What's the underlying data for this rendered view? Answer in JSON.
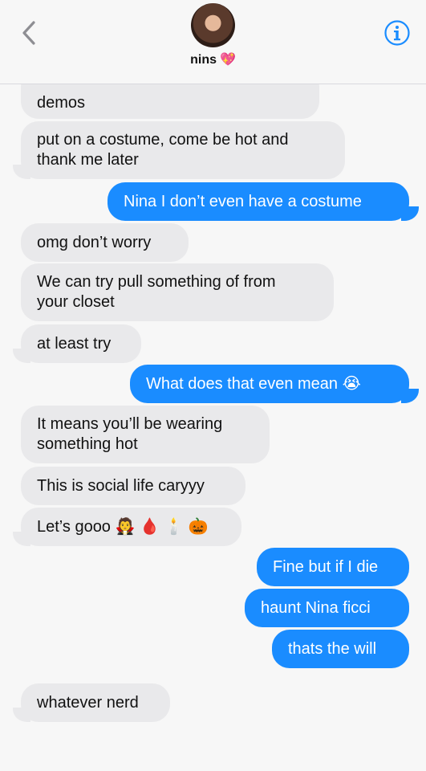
{
  "header": {
    "contact_name": "nins",
    "contact_emoji": "💖",
    "back_icon": "chevron-left-icon",
    "info_icon": "info-icon"
  },
  "messages": [
    {
      "side": "in",
      "text": "demos"
    },
    {
      "side": "in",
      "text": "put on a costume, come be hot and\nthank me later"
    },
    {
      "side": "out",
      "text": "Nina I don’t even have a costume"
    },
    {
      "side": "in",
      "text": "omg don’t worry"
    },
    {
      "side": "in",
      "text": "We can try pull something of from\nyour closet"
    },
    {
      "side": "in",
      "text": "at least try"
    },
    {
      "side": "out",
      "text": "What does that even mean 😭"
    },
    {
      "side": "in",
      "text": "It means you’ll be wearing\nsomething hot"
    },
    {
      "side": "in",
      "text": "This is social life caryyy"
    },
    {
      "side": "in",
      "text": "Let’s gooo 🧛 🩸 🕯️ 🎃"
    },
    {
      "side": "out",
      "text": "Fine but if I die"
    },
    {
      "side": "out",
      "text": "haunt Nina ficci"
    },
    {
      "side": "out",
      "text": "thats the will"
    },
    {
      "side": "in",
      "text": "whatever nerd"
    }
  ],
  "colors": {
    "incoming_bubble": "#e9e9eb",
    "outgoing_bubble": "#1a8cff",
    "accent": "#1a8cff"
  }
}
